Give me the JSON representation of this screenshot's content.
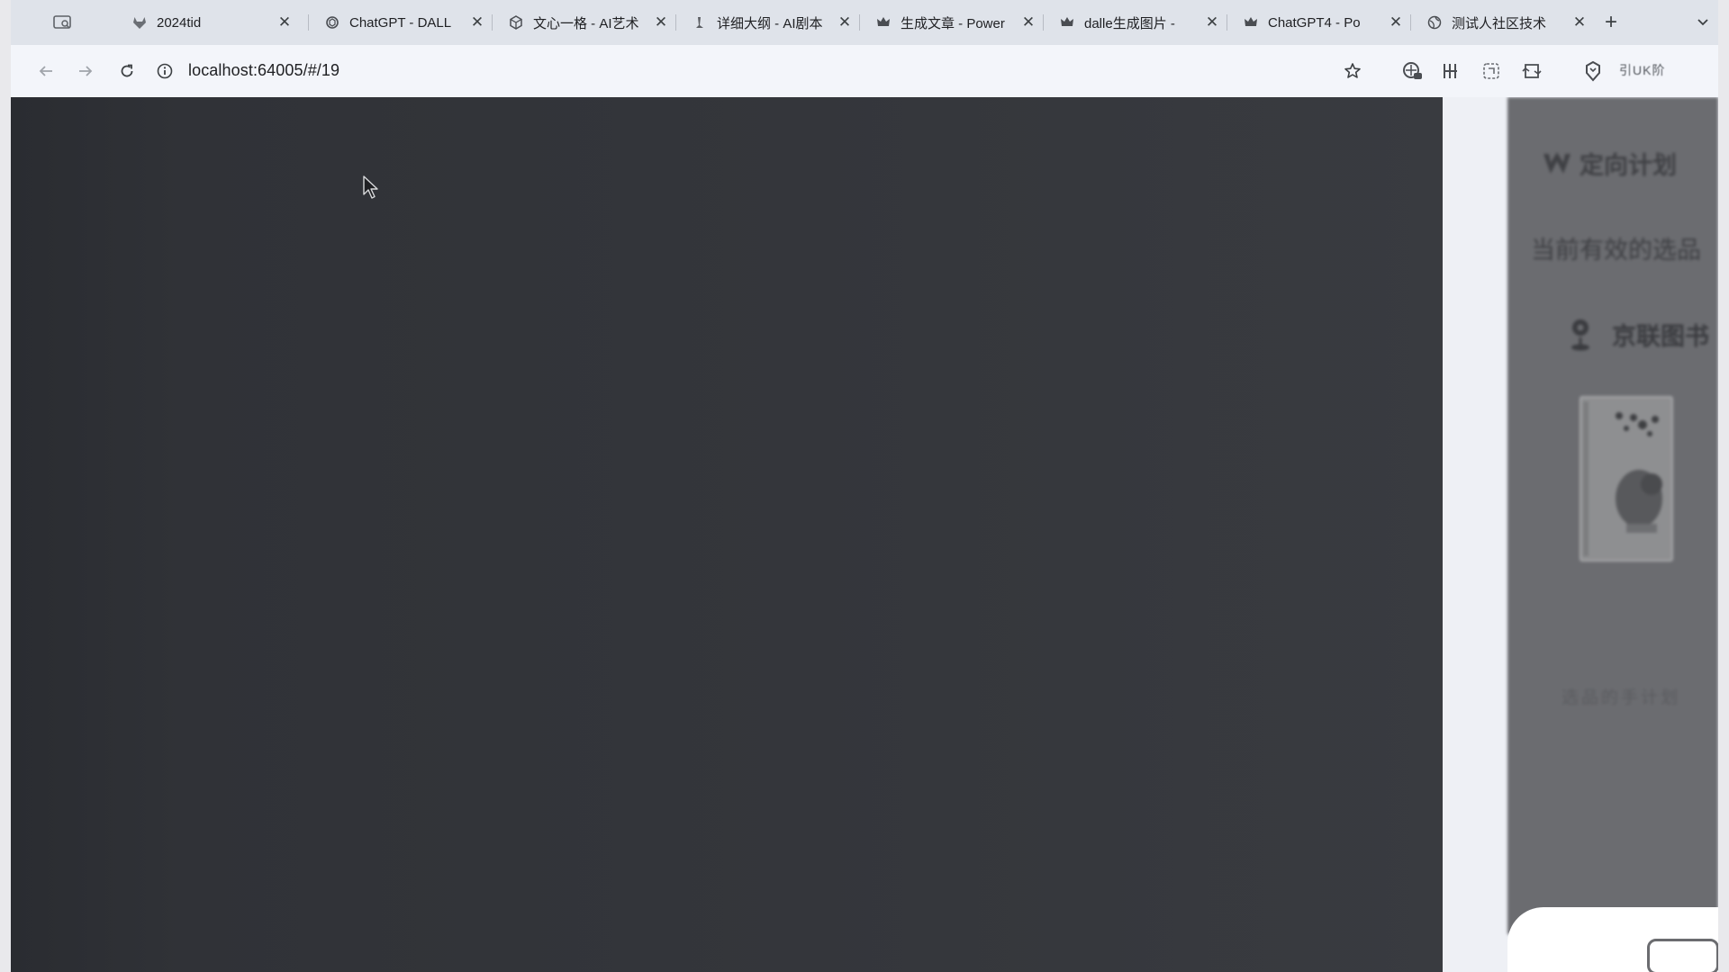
{
  "browser": {
    "tabs": [
      {
        "title": "2024tid",
        "icon": "gitlab-icon"
      },
      {
        "title": "ChatGPT - DALL",
        "icon": "openai-icon"
      },
      {
        "title": "文心一格 - AI艺术",
        "icon": "cube-icon"
      },
      {
        "title": "详细大纲 - AI剧本",
        "icon": "feather-icon"
      },
      {
        "title": "生成文章 - Power",
        "icon": "crown-icon"
      },
      {
        "title": "dalle生成图片 -",
        "icon": "crown-icon"
      },
      {
        "title": "ChatGPT4 - Po",
        "icon": "crown-icon"
      },
      {
        "title": "测试人社区技术",
        "icon": "globe-icon"
      }
    ],
    "new_tab": "+",
    "url": "localhost:64005/#/19",
    "profile_text": "引UK阶"
  },
  "side_panel": {
    "title": "定向计划",
    "subtitle": "当前有效的选品",
    "item": "京联图书",
    "footer": "选品的手计划"
  }
}
